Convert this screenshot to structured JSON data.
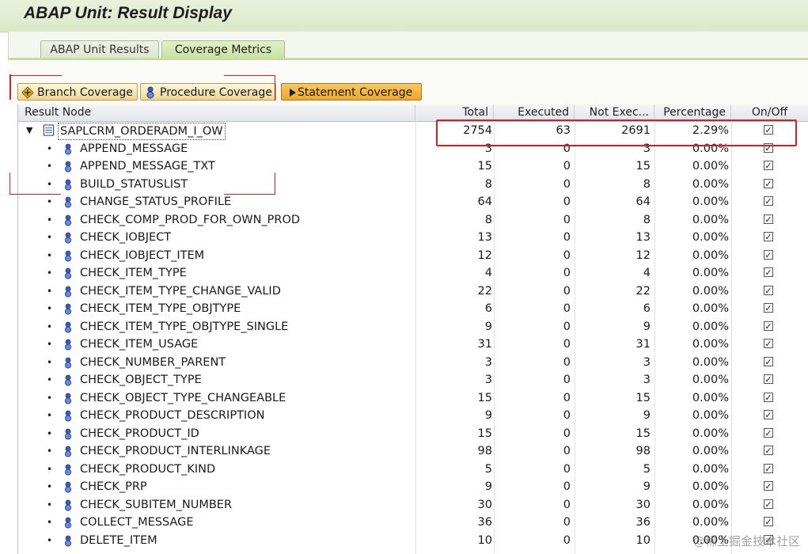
{
  "window": {
    "title": "ABAP Unit: Result Display"
  },
  "tabs": [
    {
      "label": "ABAP Unit Results",
      "active": false
    },
    {
      "label": "Coverage Metrics",
      "active": true
    }
  ],
  "toolbar": {
    "branch_label": "Branch Coverage",
    "procedure_label": "Procedure Coverage",
    "statement_label": "Statement Coverage",
    "pressed": "Statement Coverage"
  },
  "columns": {
    "node": "Result Node",
    "total": "Total",
    "executed": "Executed",
    "not_executed": "Not Exec...",
    "percentage": "Percentage",
    "onoff": "On/Off"
  },
  "root": {
    "name": "SAPLCRM_ORDERADM_I_OW",
    "total": "2754",
    "executed": "63",
    "not_executed": "2691",
    "percentage": "2.29%",
    "checked": true,
    "expanded": true
  },
  "rows": [
    {
      "name": "APPEND_MESSAGE",
      "total": "3",
      "executed": "0",
      "not_executed": "3",
      "percentage": "0.00%"
    },
    {
      "name": "APPEND_MESSAGE_TXT",
      "total": "15",
      "executed": "0",
      "not_executed": "15",
      "percentage": "0.00%"
    },
    {
      "name": "BUILD_STATUSLIST",
      "total": "8",
      "executed": "0",
      "not_executed": "8",
      "percentage": "0.00%"
    },
    {
      "name": "CHANGE_STATUS_PROFILE",
      "total": "64",
      "executed": "0",
      "not_executed": "64",
      "percentage": "0.00%"
    },
    {
      "name": "CHECK_COMP_PROD_FOR_OWN_PROD",
      "total": "8",
      "executed": "0",
      "not_executed": "8",
      "percentage": "0.00%"
    },
    {
      "name": "CHECK_IOBJECT",
      "total": "13",
      "executed": "0",
      "not_executed": "13",
      "percentage": "0.00%"
    },
    {
      "name": "CHECK_IOBJECT_ITEM",
      "total": "12",
      "executed": "0",
      "not_executed": "12",
      "percentage": "0.00%"
    },
    {
      "name": "CHECK_ITEM_TYPE",
      "total": "4",
      "executed": "0",
      "not_executed": "4",
      "percentage": "0.00%"
    },
    {
      "name": "CHECK_ITEM_TYPE_CHANGE_VALID",
      "total": "22",
      "executed": "0",
      "not_executed": "22",
      "percentage": "0.00%"
    },
    {
      "name": "CHECK_ITEM_TYPE_OBJTYPE",
      "total": "6",
      "executed": "0",
      "not_executed": "6",
      "percentage": "0.00%"
    },
    {
      "name": "CHECK_ITEM_TYPE_OBJTYPE_SINGLE",
      "total": "9",
      "executed": "0",
      "not_executed": "9",
      "percentage": "0.00%"
    },
    {
      "name": "CHECK_ITEM_USAGE",
      "total": "31",
      "executed": "0",
      "not_executed": "31",
      "percentage": "0.00%"
    },
    {
      "name": "CHECK_NUMBER_PARENT",
      "total": "3",
      "executed": "0",
      "not_executed": "3",
      "percentage": "0.00%"
    },
    {
      "name": "CHECK_OBJECT_TYPE",
      "total": "3",
      "executed": "0",
      "not_executed": "3",
      "percentage": "0.00%"
    },
    {
      "name": "CHECK_OBJECT_TYPE_CHANGEABLE",
      "total": "15",
      "executed": "0",
      "not_executed": "15",
      "percentage": "0.00%"
    },
    {
      "name": "CHECK_PRODUCT_DESCRIPTION",
      "total": "9",
      "executed": "0",
      "not_executed": "9",
      "percentage": "0.00%"
    },
    {
      "name": "CHECK_PRODUCT_ID",
      "total": "15",
      "executed": "0",
      "not_executed": "15",
      "percentage": "0.00%"
    },
    {
      "name": "CHECK_PRODUCT_INTERLINKAGE",
      "total": "98",
      "executed": "0",
      "not_executed": "98",
      "percentage": "0.00%"
    },
    {
      "name": "CHECK_PRODUCT_KIND",
      "total": "5",
      "executed": "0",
      "not_executed": "5",
      "percentage": "0.00%"
    },
    {
      "name": "CHECK_PRP",
      "total": "9",
      "executed": "0",
      "not_executed": "9",
      "percentage": "0.00%"
    },
    {
      "name": "CHECK_SUBITEM_NUMBER",
      "total": "30",
      "executed": "0",
      "not_executed": "30",
      "percentage": "0.00%"
    },
    {
      "name": "COLLECT_MESSAGE",
      "total": "36",
      "executed": "0",
      "not_executed": "36",
      "percentage": "0.00%"
    },
    {
      "name": "DELETE_ITEM",
      "total": "10",
      "executed": "0",
      "not_executed": "10",
      "percentage": "0.00%"
    }
  ],
  "row_checked": true,
  "watermark": "@稀土掘金技术社区",
  "colors": {
    "highlight_red": "#d62020",
    "tab_active": "#c9e0a0",
    "button_pressed": "#efa728"
  }
}
